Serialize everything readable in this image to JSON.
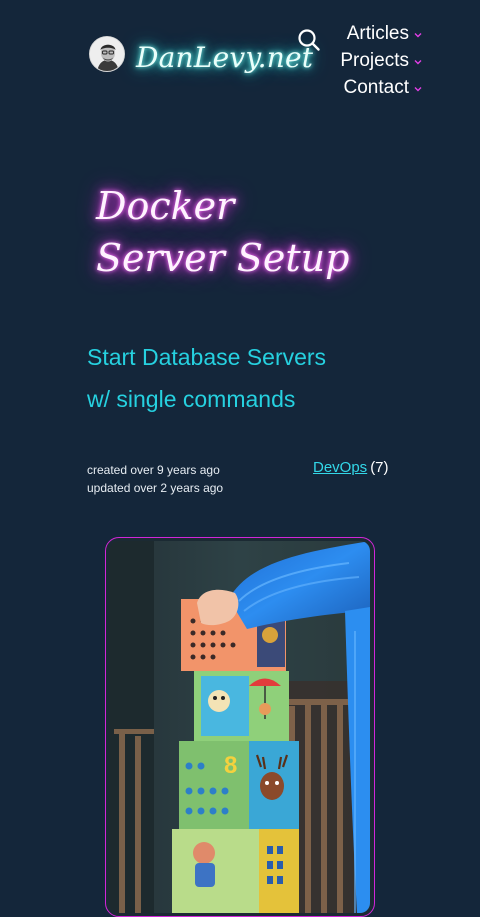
{
  "site": {
    "brand": "DanLevy.net",
    "avatar_icon": "avatar-portrait"
  },
  "nav": {
    "search_icon": "search-icon",
    "items": [
      {
        "label": "Articles"
      },
      {
        "label": "Projects"
      },
      {
        "label": "Contact"
      }
    ]
  },
  "article": {
    "title_lines": [
      "Docker",
      "Server Setup"
    ],
    "subtitle_lines": [
      "Start Database Servers",
      "w/ single commands"
    ],
    "created": "created over 9 years ago",
    "updated": "updated over 2 years ago",
    "tag": {
      "label": "DevOps",
      "count": "(7)"
    },
    "cover_image": "child stacking toy blocks"
  },
  "colors": {
    "background": "#14263a",
    "brand_glow": "#34d8d0",
    "title_glow": "#e23ee6",
    "subtitle": "#26d1e0",
    "accent_border": "#d126d8",
    "chevron": "#e23ee6"
  }
}
